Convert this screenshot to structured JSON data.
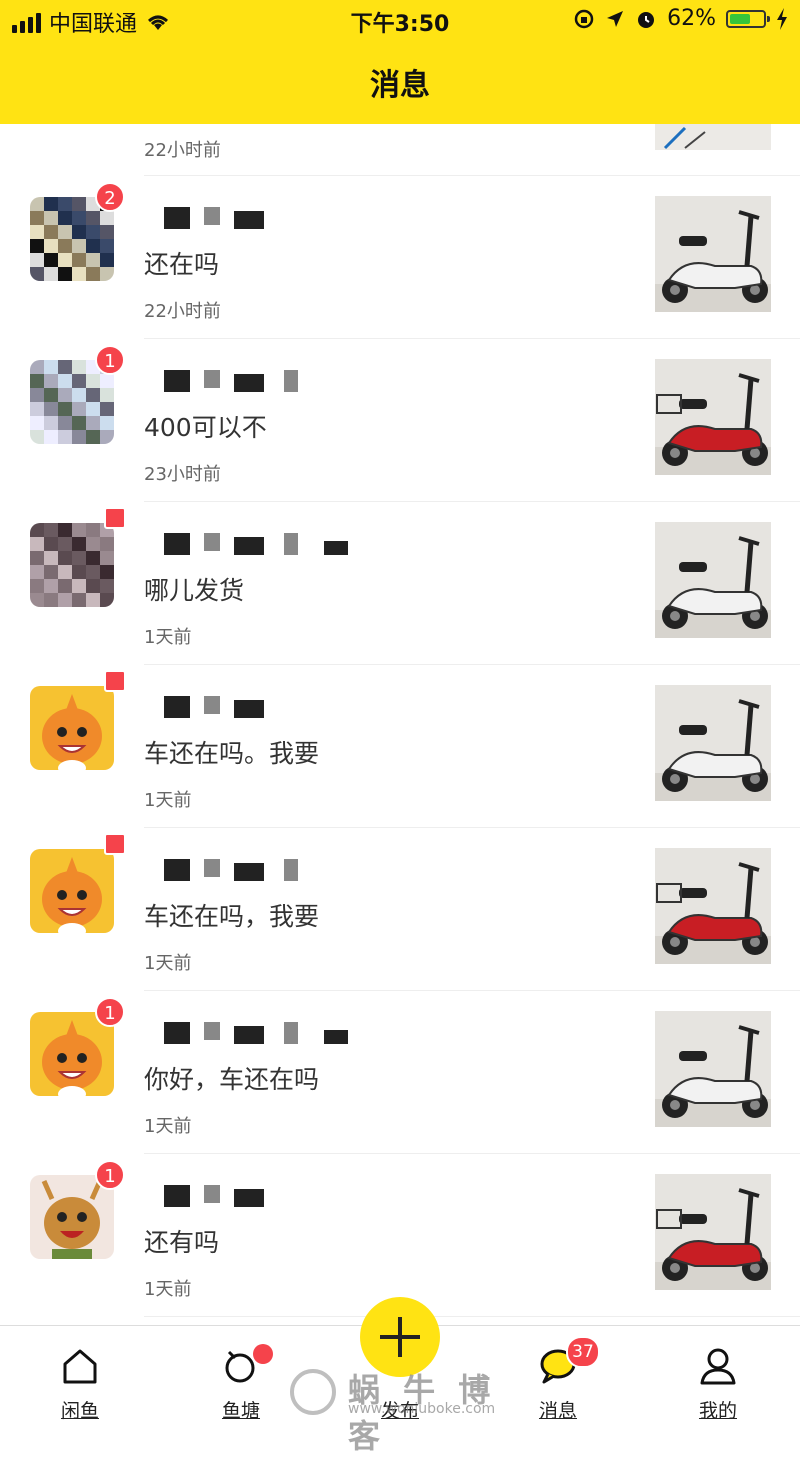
{
  "status_bar": {
    "carrier": "中国联通",
    "time": "下午3:50",
    "battery": "62%",
    "battery_level": 0.62
  },
  "header": {
    "title": "消息"
  },
  "top_partial": {
    "time": "22小时前"
  },
  "conversations": [
    {
      "badge": "2",
      "preview": "还在吗",
      "time": "22小时前",
      "avatar": "pixelated-photo",
      "bike": "white"
    },
    {
      "badge": "1",
      "preview": "400可以不",
      "time": "23小时前",
      "avatar": "pixelated-photo",
      "bike": "red"
    },
    {
      "badge": "",
      "preview": "哪儿发货",
      "time": "1天前",
      "avatar": "pixelated-photo",
      "bike": "white"
    },
    {
      "badge": "",
      "preview": "车还在吗。我要",
      "time": "1天前",
      "avatar": "orange-mascot",
      "bike": "white"
    },
    {
      "badge": "",
      "preview": "车还在吗，我要",
      "time": "1天前",
      "avatar": "orange-mascot",
      "bike": "red"
    },
    {
      "badge": "1",
      "preview": "你好，车还在吗",
      "time": "1天前",
      "avatar": "orange-mascot",
      "bike": "white"
    },
    {
      "badge": "1",
      "preview": "还有吗",
      "time": "1天前",
      "avatar": "reindeer",
      "bike": "red"
    }
  ],
  "tabbar": {
    "tabs": [
      {
        "label": "闲鱼",
        "icon": "home-icon"
      },
      {
        "label": "鱼塘",
        "icon": "pond-icon"
      },
      {
        "label": "发布",
        "icon": "plus-icon"
      },
      {
        "label": "消息",
        "icon": "chat-bubble-icon",
        "badge": "37"
      },
      {
        "label": "我的",
        "icon": "person-icon"
      }
    ]
  },
  "watermark": {
    "text": "蜗 牛 博 客",
    "url": "www.woniuboke.com"
  },
  "colors": {
    "brand_yellow": "#ffe313",
    "badge_red": "#f5434b"
  }
}
